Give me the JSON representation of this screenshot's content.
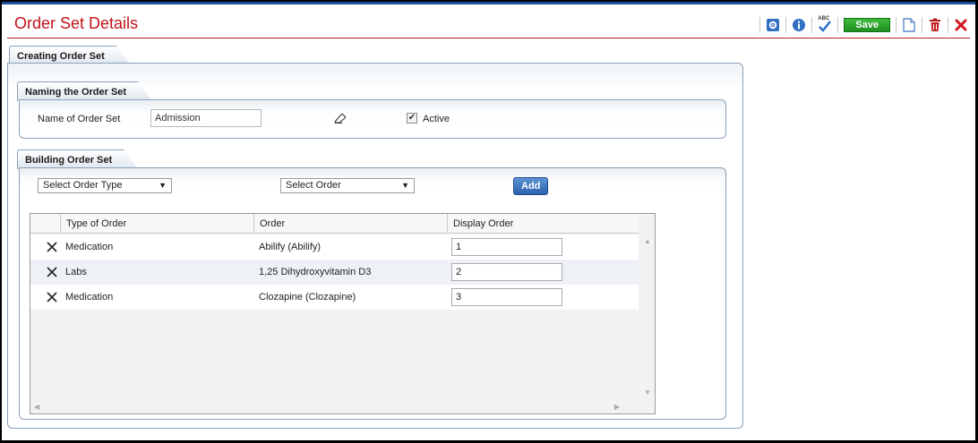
{
  "header": {
    "title": "Order Set Details"
  },
  "toolbar": {
    "save_label": "Save",
    "spellcheck_label": "ABC",
    "icons": [
      "settings-icon",
      "info-icon",
      "spellcheck-icon",
      "document-icon",
      "delete-icon",
      "close-icon"
    ]
  },
  "tabs": {
    "main": "Creating Order Set",
    "naming": "Naming the Order Set",
    "building": "Building Order Set"
  },
  "naming": {
    "name_label": "Name of Order Set",
    "name_value": "Admission",
    "active_label": "Active",
    "active_checked": true
  },
  "building": {
    "order_type_select": "Select Order Type",
    "order_select": "Select Order",
    "add_label": "Add"
  },
  "grid": {
    "columns": [
      "Type of Order",
      "Order",
      "Display Order"
    ],
    "rows": [
      {
        "type": "Medication",
        "order": "Abilify (Abilify)",
        "display_order": "1"
      },
      {
        "type": "Labs",
        "order": "1,25 Dihydroxyvitamin D3",
        "display_order": "2"
      },
      {
        "type": "Medication",
        "order": "Clozapine (Clozapine)",
        "display_order": "3"
      }
    ]
  },
  "colors": {
    "title_red": "#c0121b",
    "save_green": "#1f8e1f",
    "add_blue": "#2b62ad",
    "frame_blue": "#1f4e9c"
  }
}
